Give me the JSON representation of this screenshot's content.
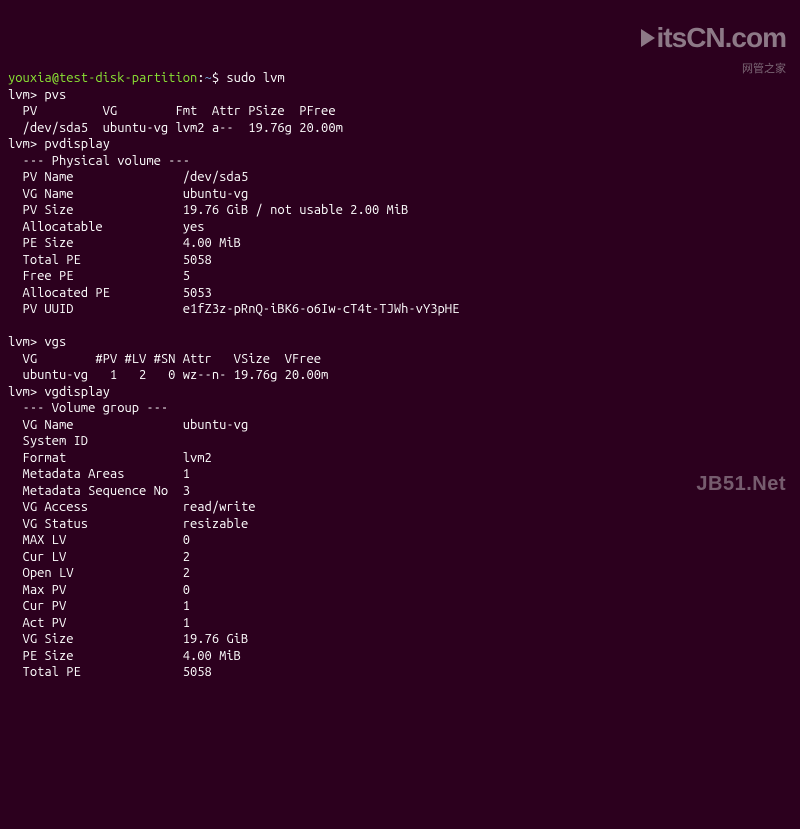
{
  "prompt": {
    "user": "youxia@test-disk-partition",
    "path": "~",
    "symbol": "$",
    "command": "sudo lvm"
  },
  "lvm_prompt": "lvm>",
  "sessions": [
    {
      "cmd": "pvs",
      "lines": [
        "  PV         VG        Fmt  Attr PSize  PFree",
        "  /dev/sda5  ubuntu-vg lvm2 a--  19.76g 20.00m"
      ]
    },
    {
      "cmd": "pvdisplay",
      "lines": [
        "  --- Physical volume ---",
        "  PV Name               /dev/sda5",
        "  VG Name               ubuntu-vg",
        "  PV Size               19.76 GiB / not usable 2.00 MiB",
        "  Allocatable           yes",
        "  PE Size               4.00 MiB",
        "  Total PE              5058",
        "  Free PE               5",
        "  Allocated PE          5053",
        "  PV UUID               e1fZ3z-pRnQ-iBK6-o6Iw-cT4t-TJWh-vY3pHE",
        ""
      ]
    },
    {
      "cmd": "vgs",
      "lines": [
        "  VG        #PV #LV #SN Attr   VSize  VFree",
        "  ubuntu-vg   1   2   0 wz--n- 19.76g 20.00m"
      ]
    },
    {
      "cmd": "vgdisplay",
      "lines": [
        "  --- Volume group ---",
        "  VG Name               ubuntu-vg",
        "  System ID",
        "  Format                lvm2",
        "  Metadata Areas        1",
        "  Metadata Sequence No  3",
        "  VG Access             read/write",
        "  VG Status             resizable",
        "  MAX LV                0",
        "  Cur LV                2",
        "  Open LV               2",
        "  Max PV                0",
        "  Cur PV                1",
        "  Act PV                1",
        "  VG Size               19.76 GiB",
        "  PE Size               4.00 MiB",
        "  Total PE              5058"
      ]
    }
  ],
  "watermarks": {
    "top_brand": "itsCN",
    "top_domain": ".com",
    "top_sub": "网管之家",
    "bottom": "JB51.Net"
  }
}
